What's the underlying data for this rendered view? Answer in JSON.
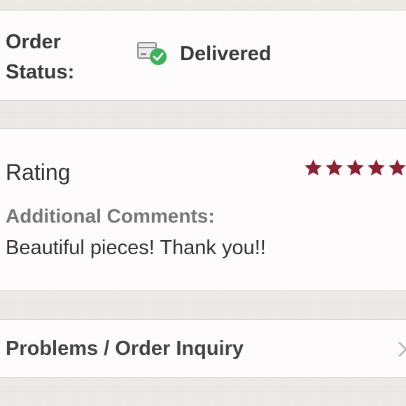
{
  "order_status": {
    "label": "Order Status:",
    "icon": "package-delivered-icon",
    "value": "Delivered",
    "accent_color": "#3cb35a"
  },
  "rating": {
    "label": "Rating",
    "stars": 5,
    "max_stars": 5,
    "star_color": "#8b2232",
    "comments_label": "Additional Comments:",
    "comments_text": "Beautiful pieces! Thank you!!"
  },
  "problems": {
    "label": "Problems / Order Inquiry",
    "icon": "chevron-right-icon"
  }
}
